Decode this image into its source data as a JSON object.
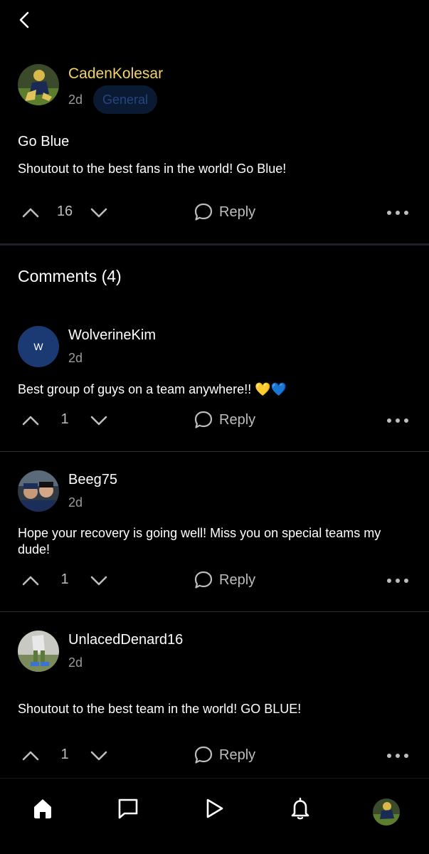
{
  "post": {
    "author": "CadenKolesar",
    "time": "2d",
    "tag": "General",
    "title": "Go Blue",
    "body": "Shoutout to the best fans in the world! Go Blue!",
    "votes": "16",
    "reply_label": "Reply"
  },
  "comments_header": "Comments (4)",
  "comments": [
    {
      "author": "WolverineKim",
      "initial": "W",
      "time": "2d",
      "text": "Best group of guys on a team anywhere!! 💛💙",
      "votes": "1",
      "reply_label": "Reply"
    },
    {
      "author": "Beeg75",
      "time": "2d",
      "text": "Hope your recovery is going well! Miss you on special teams my dude!",
      "votes": "1",
      "reply_label": "Reply"
    },
    {
      "author": "UnlacedDenard16",
      "time": "2d",
      "text": "Shoutout to the best team in the world! GO BLUE!",
      "votes": "1",
      "reply_label": "Reply"
    }
  ],
  "icons": {
    "back": "chevron-left-icon",
    "upvote": "chevron-up-icon",
    "downvote": "chevron-down-icon",
    "reply": "speech-bubble-icon",
    "more": "ellipsis-icon",
    "tabs": [
      "home-icon",
      "chat-icon",
      "play-icon",
      "bell-icon",
      "profile-avatar"
    ]
  },
  "colors": {
    "background": "#000000",
    "author_gold": "#f5d36b",
    "tag_bg": "#0a1a33",
    "tag_text": "#26467f",
    "muted": "#9a9a9a",
    "avatar_blue": "#1b3a73"
  }
}
